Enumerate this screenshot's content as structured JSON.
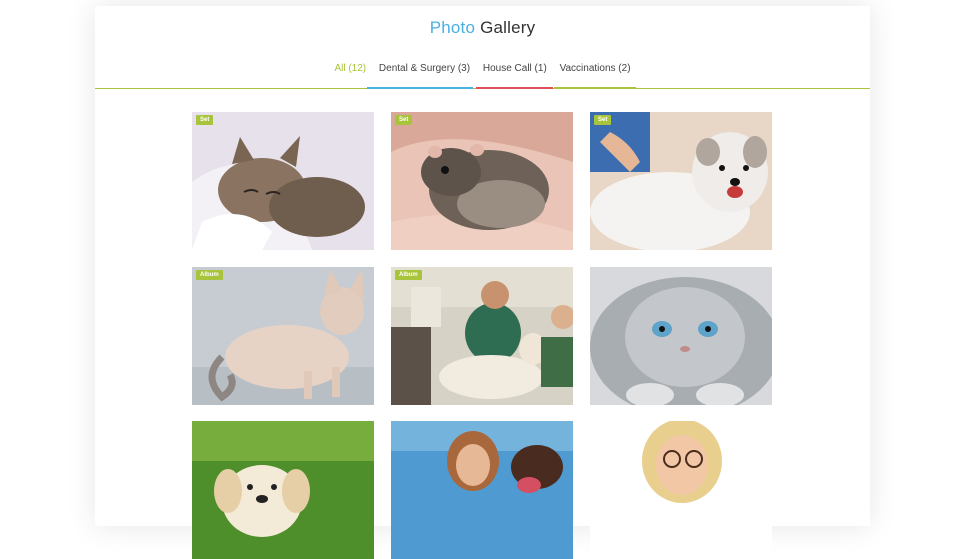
{
  "header": {
    "title_accent": "Photo",
    "title_rest": "Gallery"
  },
  "tabs": [
    {
      "label": "All (12)",
      "active": true
    },
    {
      "label": "Dental & Surgery (3)"
    },
    {
      "label": "House Call (1)"
    },
    {
      "label": "Vaccinations (2)"
    }
  ],
  "colors": {
    "accent_blue": "#4ab0e0",
    "accent_green": "#a8c43c",
    "accent_red": "#e0505a"
  },
  "gallery": [
    {
      "badge": "Set",
      "subject": "sleeping kitten"
    },
    {
      "badge": "Set",
      "subject": "hamster in hands"
    },
    {
      "badge": "Set",
      "subject": "white terrier being groomed"
    },
    {
      "badge": "Album",
      "subject": "sphynx cat"
    },
    {
      "badge": "Album",
      "subject": "vet examining dog"
    },
    {
      "badge": "",
      "subject": "grey persian kitten"
    },
    {
      "badge": "",
      "subject": "golden retriever puppy"
    },
    {
      "badge": "",
      "subject": "woman with labrador"
    },
    {
      "badge": "",
      "subject": "woman with glasses"
    }
  ]
}
